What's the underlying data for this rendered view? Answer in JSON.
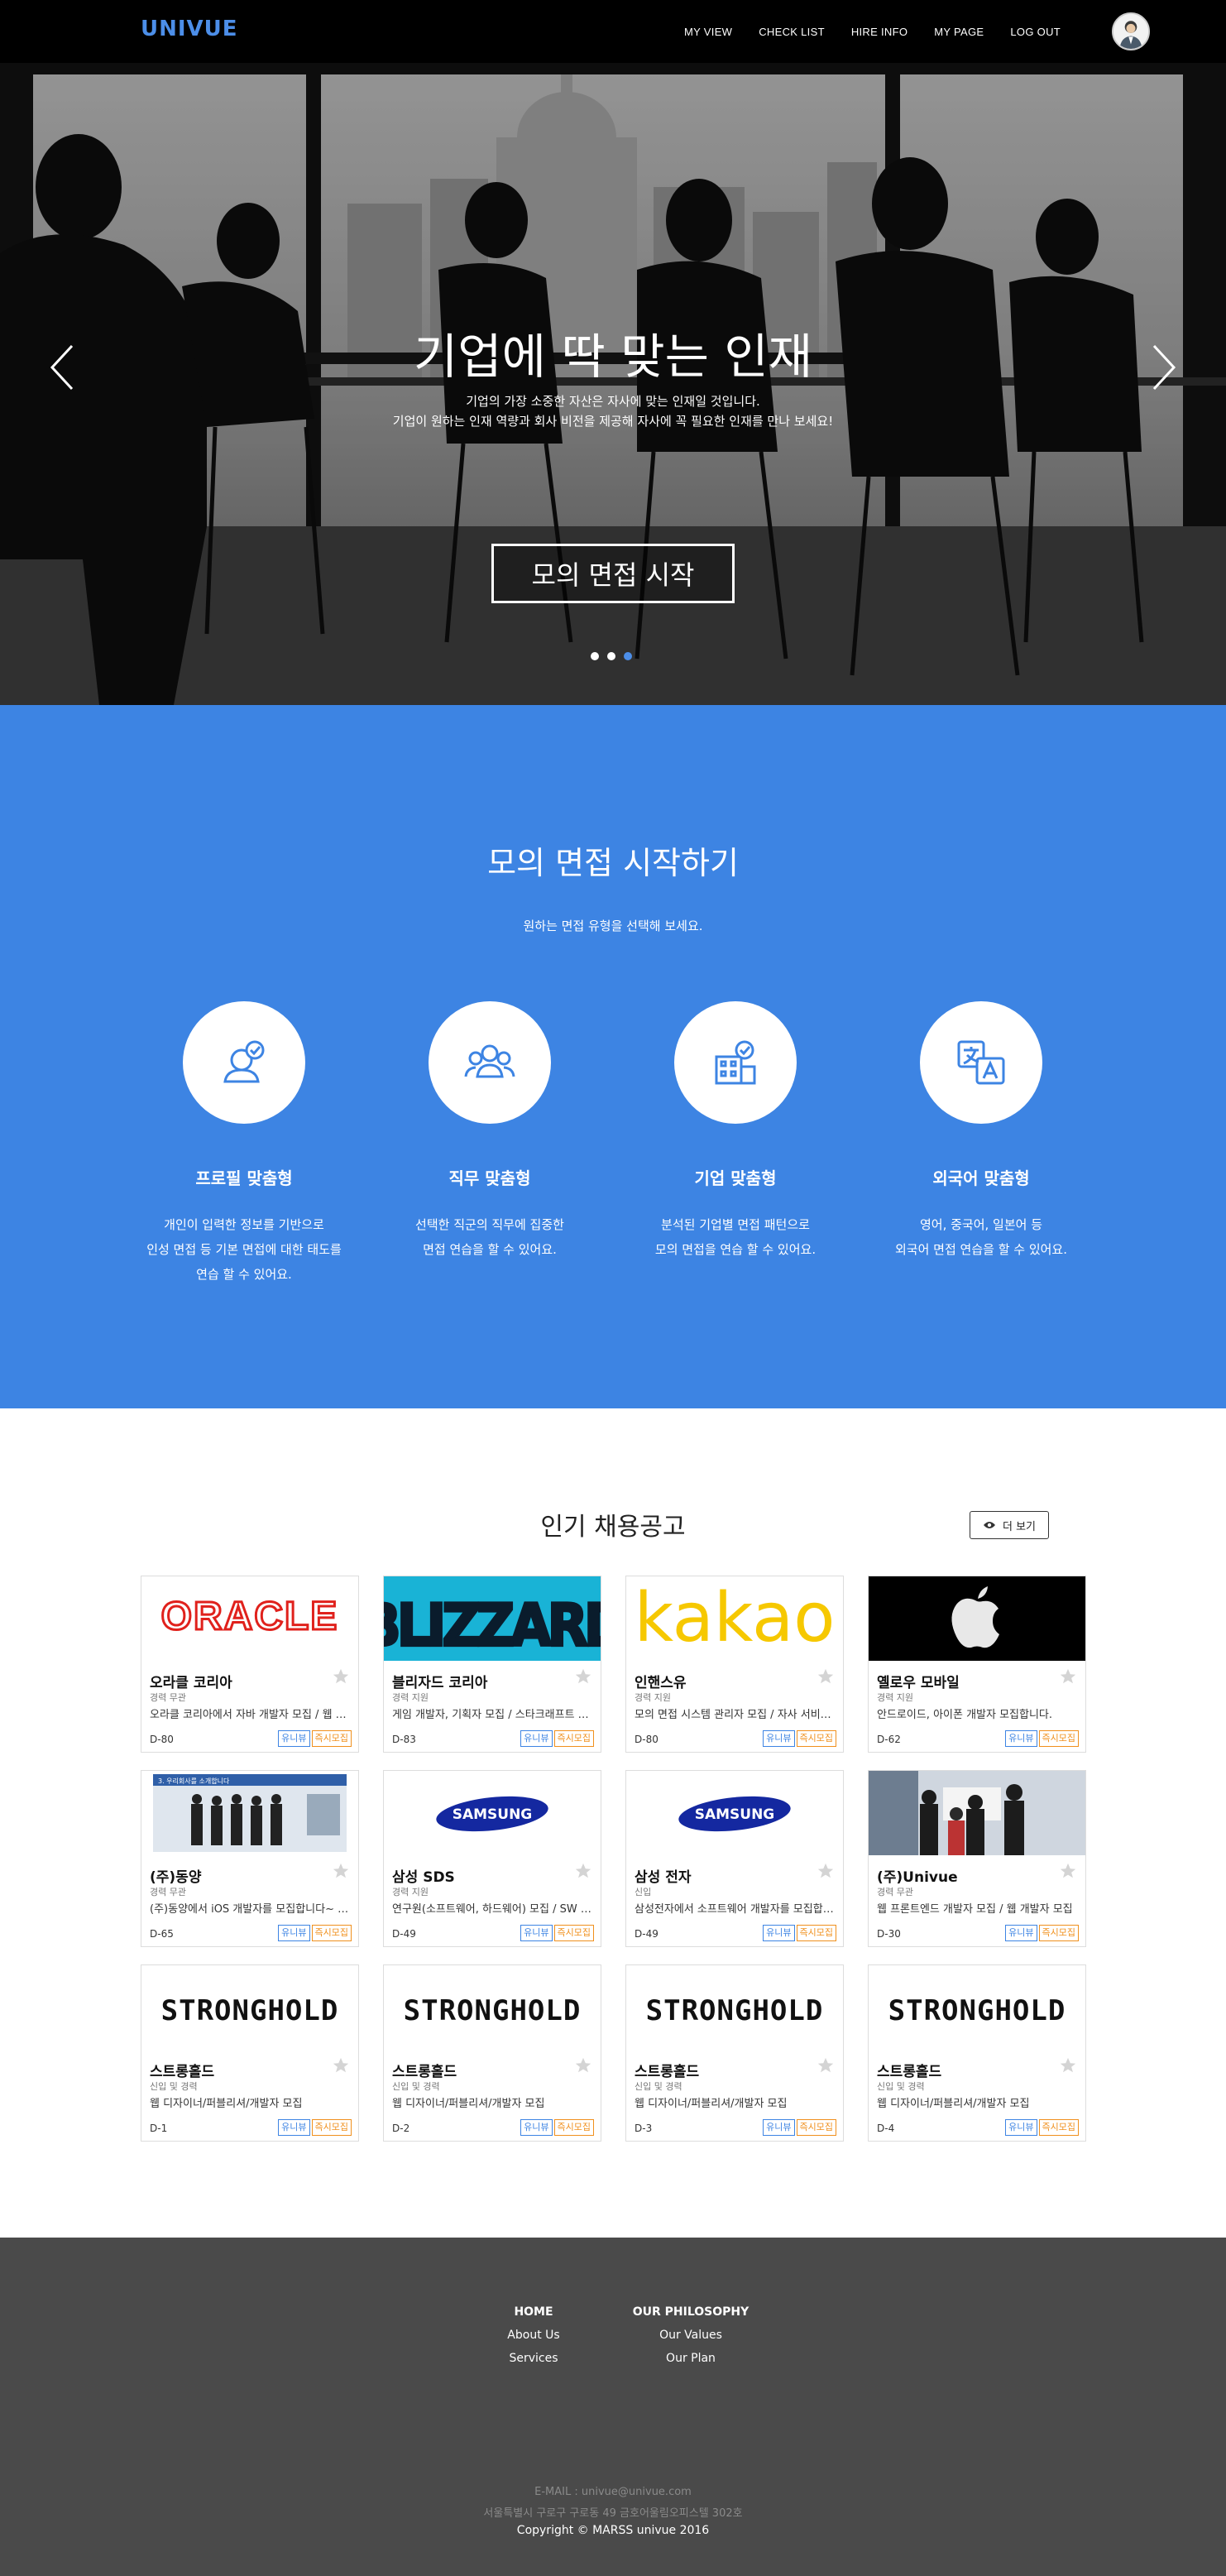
{
  "nav": {
    "brand": "UNIVUE",
    "links": [
      "MY VIEW",
      "CHECK LIST",
      "HIRE INFO",
      "MY PAGE",
      "LOG OUT"
    ]
  },
  "hero": {
    "title": "기업에 딱 맞는 인재",
    "sub1": "기업의 가장 소중한 자산은 자사에 맞는 인재일 것입니다.",
    "sub2": "기업이 원하는 인재 역량과 회사 비전을 제공해 자사에 꼭 필요한 인재를 만나 보세요!",
    "cta": "모의 면접 시작",
    "slides": 3,
    "active_slide": 3
  },
  "interview": {
    "title": "모의 면접 시작하기",
    "subtitle": "원하는 면접 유형을 선택해 보세요.",
    "types": [
      {
        "icon": "profile-check-icon",
        "name": "프로필 맞춤형",
        "desc": "개인이 입력한 정보를 기반으로\n인성 면접 등 기본 면접에 대한 태도를\n연습 할 수 있어요."
      },
      {
        "icon": "group-icon",
        "name": "직무 맞춤형",
        "desc": "선택한 직군의 직무에 집중한\n면접 연습을 할 수 있어요."
      },
      {
        "icon": "building-check-icon",
        "name": "기업 맞춤형",
        "desc": "분석된 기업별 면접 패턴으로\n모의 면접을 연습 할 수 있어요."
      },
      {
        "icon": "translate-icon",
        "name": "외국어 맞춤형",
        "desc": "영어, 중국어, 일본어 등\n외국어 면접 연습을 할 수 있어요."
      }
    ]
  },
  "jobs": {
    "title": "인기 채용공고",
    "more": "더 보기",
    "tag_blue": "유니뷰",
    "tag_orange": "즉시모집",
    "cards": [
      {
        "logo": "ORACLE",
        "name": "오라클 코리아",
        "cond": "경력 무관",
        "desc": "오라클 코리아에서 자바 개발자 모집 / 웹 개발자 모집",
        "dday": "D-80"
      },
      {
        "logo": "BLIZZARD",
        "name": "블리자드 코리아",
        "cond": "경력 지원",
        "desc": "게임 개발자, 기획자 모집 / 스타크래프트 개발",
        "dday": "D-83"
      },
      {
        "logo": "kakao",
        "name": "인핸스유",
        "cond": "경력 지원",
        "desc": "모의 면접 시스템 관리자 모집 / 자사 서비스 개발",
        "dday": "D-80"
      },
      {
        "logo": "apple-logo",
        "name": "옐로우 모바일",
        "cond": "경력 지원",
        "desc": "안드로이드, 아이폰 개발자 모집합니다.",
        "dday": "D-62"
      },
      {
        "logo": "photo-banner",
        "name": "(주)동양",
        "cond": "경력 무관",
        "desc": "(주)동양에서 iOS 개발자를 모집합니다~ 많은 지원",
        "dday": "D-65",
        "banner": "3. 우리회사를 소개합니다"
      },
      {
        "logo": "SAMSUNG",
        "name": "삼성 SDS",
        "cond": "경력 지원",
        "desc": "연구원(소프트웨어, 하드웨어) 모집 / SW 개발",
        "dday": "D-49"
      },
      {
        "logo": "SAMSUNG",
        "name": "삼성 전자",
        "cond": "신입",
        "desc": "삼성전자에서 소프트웨어 개발자를 모집합니다",
        "dday": "D-49"
      },
      {
        "logo": "photo-group",
        "name": "(주)Univue",
        "cond": "경력 무관",
        "desc": "웹 프론트엔드 개발자 모집 / 웹 개발자 모집",
        "dday": "D-30"
      },
      {
        "logo": "STRONGHOLD",
        "name": "스트롱홀드",
        "cond": "신입 및 경력",
        "desc": "웹 디자이너/퍼블리셔/개발자 모집",
        "dday": "D-1"
      },
      {
        "logo": "STRONGHOLD",
        "name": "스트롱홀드",
        "cond": "신입 및 경력",
        "desc": "웹 디자이너/퍼블리셔/개발자 모집",
        "dday": "D-2"
      },
      {
        "logo": "STRONGHOLD",
        "name": "스트롱홀드",
        "cond": "신입 및 경력",
        "desc": "웹 디자이너/퍼블리셔/개발자 모집",
        "dday": "D-3"
      },
      {
        "logo": "STRONGHOLD",
        "name": "스트롱홀드",
        "cond": "신입 및 경력",
        "desc": "웹 디자이너/퍼블리셔/개발자 모집",
        "dday": "D-4"
      }
    ]
  },
  "footer": {
    "col1": {
      "head": "HOME",
      "links": [
        "About Us",
        "Services"
      ]
    },
    "col2": {
      "head": "OUR PHILOSOPHY",
      "links": [
        "Our Values",
        "Our Plan"
      ]
    },
    "email": "E-MAIL : univue@univue.com",
    "address": "서울특별시 구로구 구로동 49 금호어울림오피스텔 302호",
    "copyright": "Copyright © MARSS univue 2016"
  },
  "colors": {
    "accent": "#3d84e3",
    "brand": "#4c8ee8",
    "nav_bg": "#000000",
    "footer_bg": "#4a4a4a",
    "tag_orange": "#f0901d"
  }
}
